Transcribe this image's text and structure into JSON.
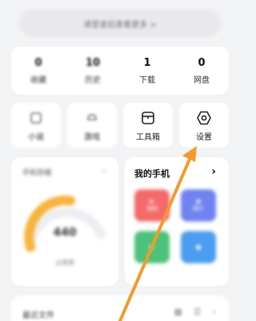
{
  "header": {
    "login_text": "请登录后查看更多 >"
  },
  "stats": [
    {
      "num": "0",
      "label": "收藏"
    },
    {
      "num": "10",
      "label": "历史"
    },
    {
      "num": "1",
      "label": "下载"
    },
    {
      "num": "0",
      "label": "网盘"
    }
  ],
  "tiles": {
    "t1": "小说",
    "t2": "游戏",
    "toolbox": "工具箱",
    "settings": "设置"
  },
  "storage": {
    "title": "手机存储",
    "value": "440",
    "subtitle": "占用率"
  },
  "phone": {
    "title": "我的手机",
    "apps": [
      "视频",
      "图片",
      "",
      ""
    ]
  },
  "recent": {
    "title": "最近文件"
  },
  "colors": {
    "background": "#f2f3f5",
    "arrow": "#f39a2c",
    "gauge": "#f6b43c"
  }
}
